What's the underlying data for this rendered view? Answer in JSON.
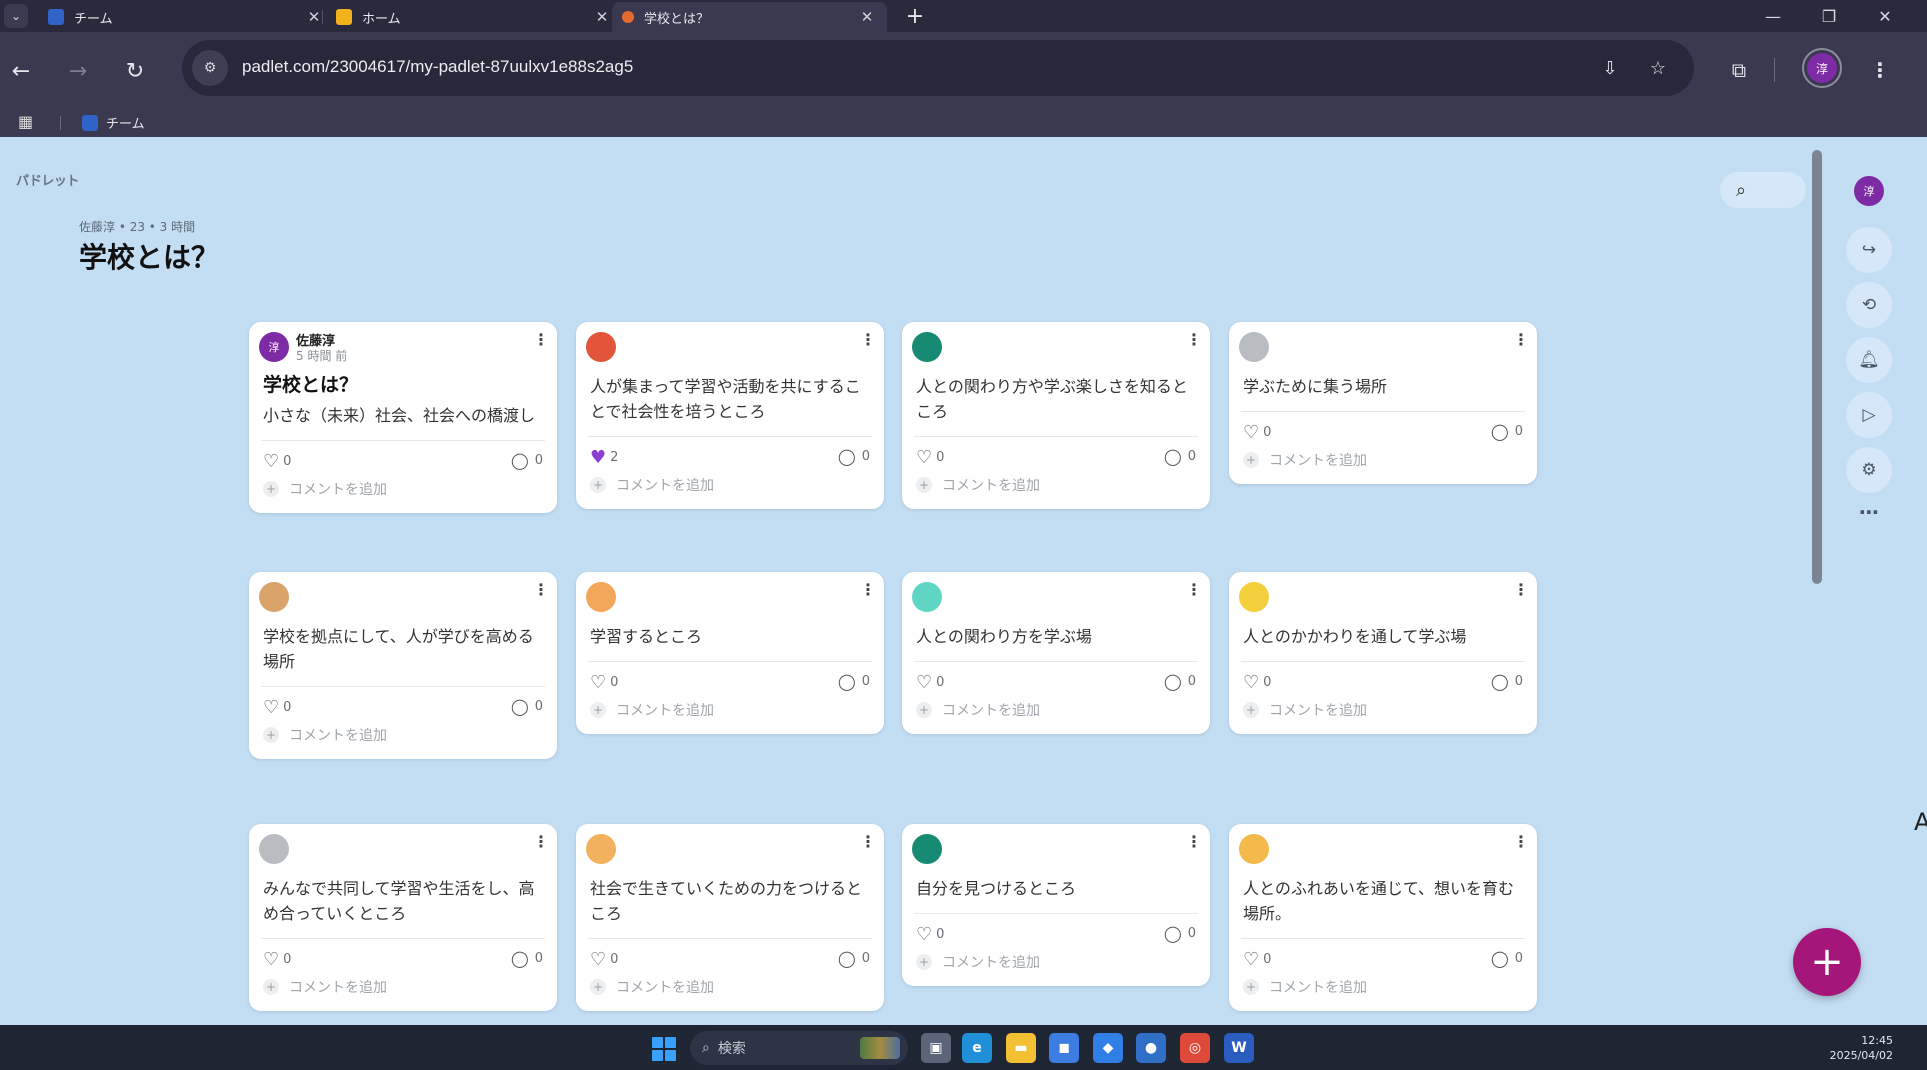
{
  "browser": {
    "tabs": [
      {
        "label": "チーム",
        "favicon_color": "#2f63c8",
        "active": false
      },
      {
        "label": "ホーム",
        "favicon_color": "#f2b21b",
        "active": false
      },
      {
        "label": "学校とは？",
        "favicon_color": "#e36b2c",
        "active": true
      }
    ],
    "new_tab": "+",
    "url": "padlet.com/23004617/my-padlet-87uulxv1e88s2ag5",
    "bookmark": {
      "label": "チーム",
      "favicon_color": "#2f63c8"
    },
    "profile_initial": "淳"
  },
  "padlet": {
    "brand": "パドレット",
    "meta": "佐藤淳 • 23 • 3 時間",
    "title": "学校とは？",
    "user_initial": "淳",
    "add_comment": "コメントを追加",
    "cards": [
      {
        "author": "佐藤淳",
        "time": "5 時間 前",
        "title": "学校とは？",
        "body": "小さな（未来）社会、社会への橋渡し",
        "likes": "0",
        "comments": "0",
        "avatar_color": "#7d2ba4",
        "avatar_text": "淳",
        "liked": false
      },
      {
        "author": "",
        "time": "",
        "title": "",
        "body": "人が集まって学習や活動を共にすることで社会性を培うところ",
        "likes": "2",
        "comments": "0",
        "avatar_color": "#e2553a",
        "avatar_text": "",
        "liked": true
      },
      {
        "author": "",
        "time": "",
        "title": "",
        "body": "人との関わり方や学ぶ楽しさを知るところ",
        "likes": "0",
        "comments": "0",
        "avatar_color": "#168a72",
        "avatar_text": "",
        "liked": false
      },
      {
        "author": "",
        "time": "",
        "title": "",
        "body": "学ぶために集う場所",
        "likes": "0",
        "comments": "0",
        "avatar_color": "#b9bdc2",
        "avatar_text": "",
        "liked": false
      },
      {
        "author": "",
        "time": "",
        "title": "",
        "body": "学校を拠点にして、人が学びを高める場所",
        "likes": "0",
        "comments": "0",
        "avatar_color": "#d9a36a",
        "avatar_text": "",
        "liked": false
      },
      {
        "author": "",
        "time": "",
        "title": "",
        "body": "学習するところ",
        "likes": "0",
        "comments": "0",
        "avatar_color": "#f2a75a",
        "avatar_text": "",
        "liked": false
      },
      {
        "author": "",
        "time": "",
        "title": "",
        "body": "人との関わり方を学ぶ場",
        "likes": "0",
        "comments": "0",
        "avatar_color": "#5fd6c4",
        "avatar_text": "",
        "liked": false
      },
      {
        "author": "",
        "time": "",
        "title": "",
        "body": "人とのかかわりを通して学ぶ場",
        "likes": "0",
        "comments": "0",
        "avatar_color": "#f3cf3c",
        "avatar_text": "",
        "liked": false
      },
      {
        "author": "",
        "time": "",
        "title": "",
        "body": "みんなで共同して学習や生活をし、高め合っていくところ",
        "likes": "0",
        "comments": "0",
        "avatar_color": "#b9bdc2",
        "avatar_text": "",
        "liked": false
      },
      {
        "author": "",
        "time": "",
        "title": "",
        "body": "社会で生きていくための力をつけるところ",
        "likes": "0",
        "comments": "0",
        "avatar_color": "#f2b15c",
        "avatar_text": "",
        "liked": false
      },
      {
        "author": "",
        "time": "",
        "title": "",
        "body": "自分を見つけるところ",
        "likes": "0",
        "comments": "0",
        "avatar_color": "#168a72",
        "avatar_text": "",
        "liked": false
      },
      {
        "author": "",
        "time": "",
        "title": "",
        "body": "人とのふれあいを通じて、想いを育む場所。",
        "likes": "0",
        "comments": "0",
        "avatar_color": "#f3b94a",
        "avatar_text": "",
        "liked": false
      }
    ]
  },
  "taskbar": {
    "search_placeholder": "検索",
    "time": "12:45",
    "date": "2025/04/02",
    "apps": [
      {
        "name": "task-view",
        "color": "#5b6478",
        "glyph": "▣"
      },
      {
        "name": "edge",
        "color": "#1f8fd8",
        "glyph": "e"
      },
      {
        "name": "file-explorer",
        "color": "#f3c033",
        "glyph": "▬"
      },
      {
        "name": "teams",
        "color": "#3b7de0",
        "glyph": "◼"
      },
      {
        "name": "app",
        "color": "#2f7fe6",
        "glyph": "◆"
      },
      {
        "name": "app2",
        "color": "#2f6fc8",
        "glyph": "●"
      },
      {
        "name": "chrome",
        "color": "#dd4a3a",
        "glyph": "◎"
      },
      {
        "name": "word",
        "color": "#2b5cc0",
        "glyph": "W"
      }
    ]
  },
  "edge_glyph": "A"
}
